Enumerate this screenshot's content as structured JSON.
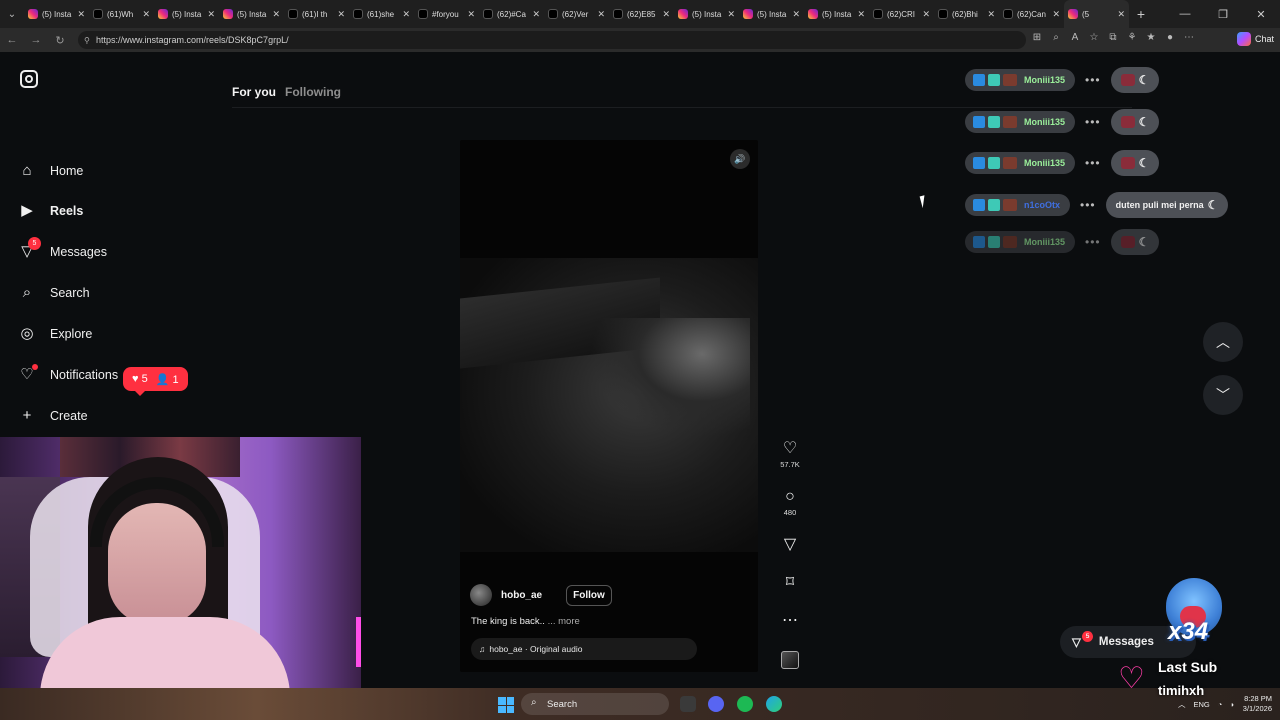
{
  "browser": {
    "tabs": [
      {
        "title": "(5) Insta",
        "icon": "instagram-icon",
        "active": false
      },
      {
        "title": "(61)Wh",
        "icon": "tiktok-icon",
        "active": false
      },
      {
        "title": "(5) Insta",
        "icon": "instagram-icon",
        "active": false
      },
      {
        "title": "(5) Insta",
        "icon": "instagram-icon",
        "active": false
      },
      {
        "title": "(61)I th",
        "icon": "tiktok-icon",
        "active": false
      },
      {
        "title": "(61)she",
        "icon": "tiktok-icon",
        "active": false
      },
      {
        "title": "#foryou",
        "icon": "tiktok-icon",
        "active": false
      },
      {
        "title": "(62)#Ca",
        "icon": "tiktok-icon",
        "active": false
      },
      {
        "title": "(62)Ver",
        "icon": "tiktok-icon",
        "active": false
      },
      {
        "title": "(62)E85",
        "icon": "tiktok-icon",
        "active": false
      },
      {
        "title": "(5) Insta",
        "icon": "instagram-icon",
        "active": false
      },
      {
        "title": "(5) Insta",
        "icon": "instagram-icon",
        "active": false
      },
      {
        "title": "(5) Insta",
        "icon": "instagram-icon",
        "active": false
      },
      {
        "title": "(62)CRI",
        "icon": "tiktok-icon",
        "active": false
      },
      {
        "title": "(62)Bhi",
        "icon": "tiktok-icon",
        "active": false
      },
      {
        "title": "(62)Can",
        "icon": "tiktok-icon",
        "active": false
      },
      {
        "title": "(5",
        "icon": "instagram-icon",
        "active": true
      }
    ],
    "url": "https://www.instagram.com/reels/DSK8pC7grpL/",
    "chat_label": "Chat"
  },
  "instagram": {
    "feed_tabs": {
      "active": "For you",
      "inactive": "Following"
    },
    "nav": [
      {
        "label": "Home",
        "icon": "home-icon"
      },
      {
        "label": "Reels",
        "icon": "reels-icon"
      },
      {
        "label": "Messages",
        "icon": "messages-icon",
        "badge": "5"
      },
      {
        "label": "Search",
        "icon": "search-icon"
      },
      {
        "label": "Explore",
        "icon": "explore-icon"
      },
      {
        "label": "Notifications",
        "icon": "heart-icon"
      },
      {
        "label": "Create",
        "icon": "plus-icon"
      }
    ],
    "notifications_pill": {
      "likes": "5",
      "follows": "1"
    },
    "reel": {
      "username": "hobo_ae",
      "follow_label": "Follow",
      "caption": "The king is back..",
      "more_label": "... more",
      "audio": "hobo_ae · Original audio",
      "likes": "57.7K",
      "comments": "480"
    },
    "messages_pill": {
      "label": "Messages",
      "badge": "5"
    }
  },
  "stream_overlay": {
    "chat": [
      {
        "user": "Moniii135",
        "message": ""
      },
      {
        "user": "Moniii135",
        "message": ""
      },
      {
        "user": "Moniii135",
        "message": ""
      },
      {
        "user": "n1coOtx",
        "message": "duten puli mei perna"
      },
      {
        "user": "Moniii135",
        "message": ""
      }
    ],
    "sub_count": "x34",
    "last_sub_label": "Last Sub",
    "last_sub_name": "timihxh"
  },
  "taskbar": {
    "search_placeholder": "Search",
    "lang": "ENG",
    "time": "8:28 PM",
    "date": "3/1/2026"
  }
}
